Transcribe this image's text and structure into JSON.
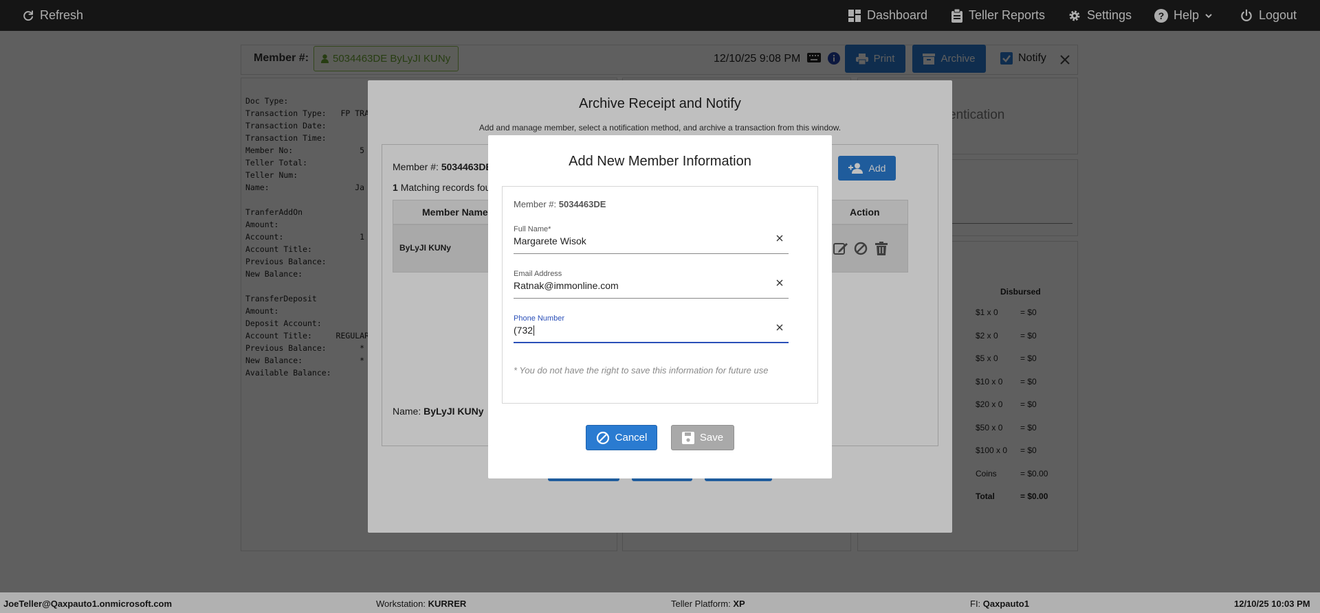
{
  "topnav": {
    "refresh": "Refresh",
    "dashboard": "Dashboard",
    "teller_reports": "Teller Reports",
    "settings": "Settings",
    "help": "Help",
    "logout": "Logout"
  },
  "header": {
    "member_label": "Member #:",
    "member_badge": "5034463DE ByLyJI KUNy",
    "datetime": "12/10/25 9:08 PM",
    "print": "Print",
    "archive": "Archive",
    "notify": "Notify"
  },
  "receipt": {
    "lines": "Doc Type:\nTransaction Type:   FP TRA\nTransaction Date:\nTransaction Time:\nMember No:              5\nTeller Total:\nTeller Num:\nName:                  Ja\n\nTranferAddOn\nAmount:\nAccount:                1\nAccount Title:\nPrevious Balance:\nNew Balance:\n\nTransferDeposit\nAmount:\nDeposit Account:\nAccount Title:     REGULAR\nPrevious Balance:       *\nNew Balance:            *\nAvailable Balance:"
  },
  "right_panel": {
    "auth_title": "entication",
    "disbursed_header": "Disbursed",
    "rows": [
      {
        "label": "$1 x 0",
        "value": "= $0"
      },
      {
        "label": "$2 x 0",
        "value": "= $0"
      },
      {
        "label": "$5 x 0",
        "value": "= $0"
      },
      {
        "label": "$10 x 0",
        "value": "= $0"
      },
      {
        "label": "$20 x 0",
        "value": "= $0"
      },
      {
        "label": "$50 x 0",
        "value": "= $0"
      },
      {
        "label": "$100 x 0",
        "value": "= $0"
      },
      {
        "label": "Coins",
        "value": "= $0.00"
      },
      {
        "label": "Total",
        "value": "= $0.00"
      }
    ]
  },
  "archive_modal": {
    "title": "Archive Receipt and Notify",
    "subtitle": "Add and manage member, select a notification method, and archive a transaction from this window.",
    "member_label": "Member #:",
    "member_value": "5034463DE",
    "add_button": "Add",
    "matching_count": "1",
    "matching_text": "Matching records fou",
    "col_member_name": "Member Name",
    "col_action": "Action",
    "row_name": "ByLyJI KUNy",
    "name_label": "Name:",
    "name_value": "ByLyJI KUNy"
  },
  "add_member_modal": {
    "title": "Add New Member Information",
    "member_label": "Member #:",
    "member_value": "5034463DE",
    "full_name_label": "Full Name*",
    "full_name_value": "Margarete Wisok",
    "email_label": "Email Address",
    "email_value": "Ratnak@immonline.com",
    "phone_label": "Phone Number",
    "phone_value": "(732",
    "note": "* You do not have the right to save this information for future use",
    "cancel": "Cancel",
    "save": "Save"
  },
  "footer": {
    "user": "JoeTeller@Qaxpauto1.onmicrosoft.com",
    "workstation_label": "Workstation:",
    "workstation_value": "KURRER",
    "platform_label": "Teller Platform:",
    "platform_value": "XP",
    "fi_label": "FI:",
    "fi_value": "Qaxpauto1",
    "datetime": "12/10/25 10:03 PM"
  },
  "colors": {
    "accent": "#2a7bd1",
    "badge_green": "#6aa431",
    "nav_bg": "#1c1c1c"
  }
}
